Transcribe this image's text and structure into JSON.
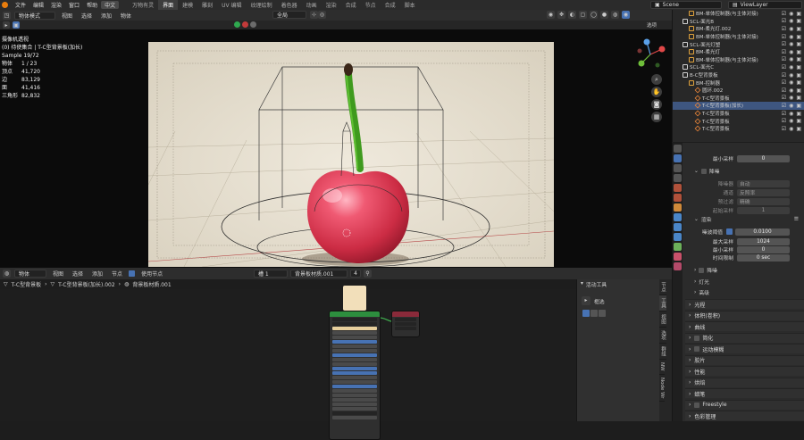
{
  "topbar": {
    "menus": [
      "文件",
      "编辑",
      "渲染",
      "窗口",
      "帮助"
    ],
    "lang": "中文",
    "workspaces": [
      "万物有灵",
      "界面",
      "建模",
      "雕刻",
      "UV 编辑",
      "纹理绘制",
      "着色器",
      "动画",
      "渲染",
      "合成",
      "节点",
      "合成",
      "脚本"
    ],
    "active_workspace": "界面",
    "scene": "Scene",
    "view_layer": "ViewLayer"
  },
  "viewport_header": {
    "mode": "物体模式",
    "menus": [
      "视图",
      "选择",
      "添加",
      "物体"
    ],
    "transform": "全局",
    "options": "选项"
  },
  "viewport_stats": {
    "title": "摄像机透视",
    "subtitle": "(0) 待使集合 | T-C型背景板(加长)",
    "sample": "Sample 19/72",
    "rows": [
      {
        "k": "物体",
        "v": "1 / 23"
      },
      {
        "k": "顶点",
        "v": "41,720"
      },
      {
        "k": "边",
        "v": "83,129"
      },
      {
        "k": "面",
        "v": "41,416"
      },
      {
        "k": "三角形",
        "v": "82,832"
      }
    ]
  },
  "node_header": {
    "object": "物体",
    "menus": [
      "视图",
      "选择",
      "添加",
      "节点"
    ],
    "use_nodes": "使用节点",
    "slot": "槽 1",
    "material": "背景板材质.001",
    "users": "4"
  },
  "breadcrumb": [
    "T-C型背景板",
    "T-C型背景板(加长).002",
    "背景板材质.001"
  ],
  "tool_panel": {
    "title": "活动工具",
    "tool": "框选"
  },
  "side_tabs": [
    "节点",
    "工具",
    "视图",
    "选项",
    "群组",
    "NW",
    "Node Wr"
  ],
  "outliner": [
    {
      "label": "BM-单体控制器(与主体对接)",
      "indent": 2,
      "kind": "empty"
    },
    {
      "label": "SCL-面光B",
      "indent": 1,
      "kind": "coll"
    },
    {
      "label": "BM-柔光灯.002",
      "indent": 2,
      "kind": "empty"
    },
    {
      "label": "BM-单体控制器(与主体对接)",
      "indent": 2,
      "kind": "empty"
    },
    {
      "label": "SCL-面光灯塑",
      "indent": 1,
      "kind": "coll"
    },
    {
      "label": "BM-柔光灯",
      "indent": 2,
      "kind": "empty"
    },
    {
      "label": "BM-单体控制器(与主体对接)",
      "indent": 2,
      "kind": "empty"
    },
    {
      "label": "SCL-面光C",
      "indent": 1,
      "kind": "coll"
    },
    {
      "label": "B-C型背景板",
      "indent": 1,
      "kind": "coll"
    },
    {
      "label": "BM-控制器",
      "indent": 2,
      "kind": "empty"
    },
    {
      "label": "圆环.002",
      "indent": 3,
      "kind": "mesh"
    },
    {
      "label": "T-C型背景板",
      "indent": 3,
      "kind": "mesh"
    },
    {
      "label": "T-C型背景板(加长)",
      "indent": 3,
      "kind": "mesh",
      "selected": true
    },
    {
      "label": "T-C型背景板",
      "indent": 3,
      "kind": "mesh"
    },
    {
      "label": "T-C型背景板",
      "indent": 3,
      "kind": "mesh"
    },
    {
      "label": "T-C型背景板",
      "indent": 3,
      "kind": "mesh"
    }
  ],
  "properties": {
    "min_samples_label": "最小采样",
    "min_samples": "0",
    "denoise_section": "降噪",
    "denoiser_label": "降噪器",
    "denoiser": "自动",
    "passes_label": "通道",
    "passes": "反照率",
    "prefilter_label": "预过滤",
    "prefilter": "精确",
    "start_sample_label": "起始采样",
    "start_sample": "1",
    "render_section": "渲染",
    "noise_threshold_label": "噪波阈值",
    "noise_threshold": "0.0100",
    "max_samples_label": "最大采样",
    "max_samples": "1024",
    "min_samples2_label": "最小采样",
    "min_samples2": "0",
    "time_limit_label": "时间限制",
    "time_limit": "0 sec",
    "sub_sections": [
      "降噪",
      "灯光",
      "高级"
    ],
    "sections": [
      "光程",
      "体积(卷积)",
      "曲线",
      "简化",
      "运动模糊",
      "胶片",
      "性能",
      "烘焙",
      "蜡笔",
      "Freestyle",
      "色彩管理"
    ]
  },
  "colors": {
    "accent_orange": "#e87d0d",
    "select_blue": "#4772b3",
    "cherry_red": "#d8344e",
    "stem_green": "#3f9a1e"
  }
}
